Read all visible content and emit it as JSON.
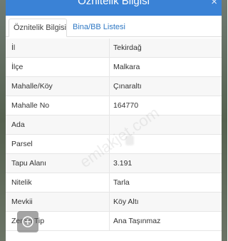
{
  "dialog": {
    "title": "Öznitelik Bilgisi",
    "close_glyph": "×"
  },
  "tabs": [
    {
      "label": "Öznitelik Bilgisi",
      "active": true
    },
    {
      "label": "Bina/BB Listesi",
      "active": false
    }
  ],
  "rows": [
    {
      "key": "İl",
      "value": "Tekirdağ"
    },
    {
      "key": "İlçe",
      "value": "Malkara"
    },
    {
      "key": "Mahalle/Köy",
      "value": "Çınaraltı"
    },
    {
      "key": "Mahalle No",
      "value": "164770"
    },
    {
      "key": "Ada",
      "value": ""
    },
    {
      "key": "Parsel",
      "value": ""
    },
    {
      "key": "Tapu Alanı",
      "value": "3.191"
    },
    {
      "key": "Nitelik",
      "value": "Tarla"
    },
    {
      "key": "Mevkii",
      "value": "Köy Altı"
    },
    {
      "key": "Zemin Tip",
      "value": "Ana Taşınmaz"
    }
  ],
  "watermark": {
    "text": "emlakjet.com"
  },
  "colors": {
    "header": "#3a82d6",
    "tab_active_text": "#444444",
    "tab_inactive_text": "#2f78c4"
  },
  "icons": {
    "close": "close-icon",
    "watermark_logo": "emlakjet-logo-icon"
  }
}
